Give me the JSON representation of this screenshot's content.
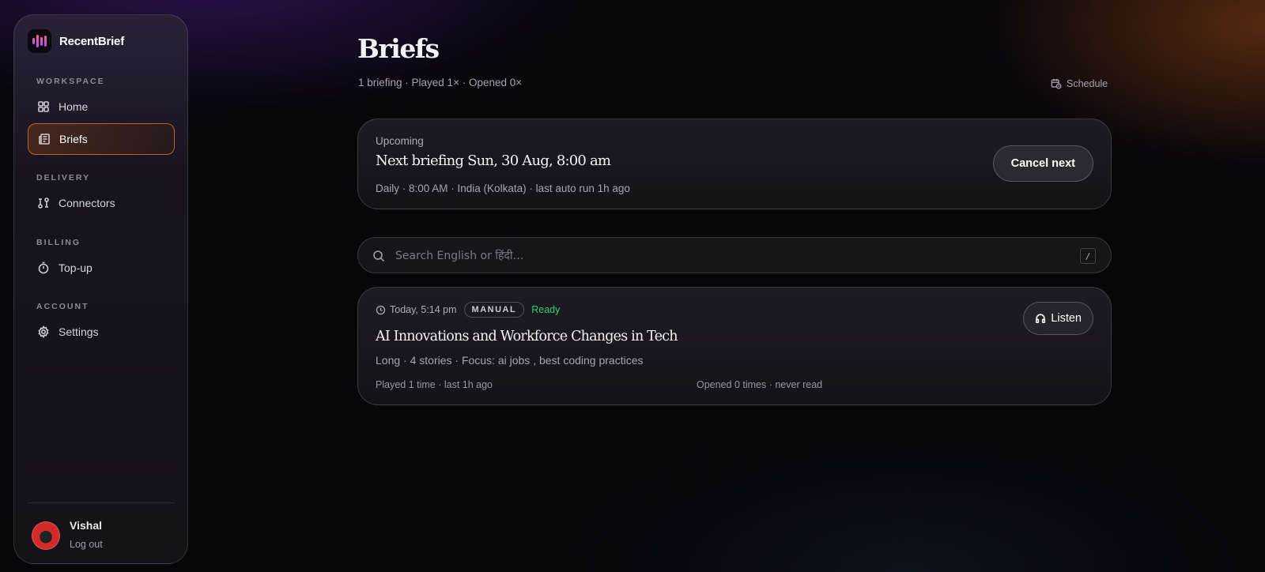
{
  "app": {
    "name": "RecentBrief"
  },
  "sidebar": {
    "sections": [
      {
        "label": "WORKSPACE",
        "items": [
          {
            "label": "Home",
            "icon": "grid-icon"
          },
          {
            "label": "Briefs",
            "icon": "newspaper-icon",
            "active": true
          }
        ]
      },
      {
        "label": "DELIVERY",
        "items": [
          {
            "label": "Connectors",
            "icon": "connectors-icon"
          }
        ]
      },
      {
        "label": "BILLING",
        "items": [
          {
            "label": "Top-up",
            "icon": "timer-icon"
          }
        ]
      },
      {
        "label": "ACCOUNT",
        "items": [
          {
            "label": "Settings",
            "icon": "gear-icon"
          }
        ]
      }
    ],
    "user": {
      "name": "Vishal",
      "logout_label": "Log out"
    }
  },
  "page": {
    "title": "Briefs",
    "subtitle": "1 briefing · Played 1× · Opened 0×",
    "schedule_label": "Schedule"
  },
  "upcoming": {
    "label": "Upcoming",
    "title": "Next briefing Sun, 30 Aug, 8:00 am",
    "meta": "Daily · 8:00 AM · India (Kolkata) · last auto run 1h ago",
    "cancel_label": "Cancel next"
  },
  "search": {
    "placeholder": "Search English or हिंदी…",
    "shortcut": "/"
  },
  "briefs": [
    {
      "time": "Today, 5:14 pm",
      "badge": "MANUAL",
      "status": "Ready",
      "title": "AI Innovations and Workforce Changes in Tech",
      "meta": "Long · 4 stories · Focus: ai jobs , best coding practices",
      "played": "Played 1 time · last 1h ago",
      "opened": "Opened 0 times · never read",
      "listen_label": "Listen"
    }
  ],
  "colors": {
    "accent": "#b8652a",
    "status_ready": "#2bd46b",
    "background": "#07060b"
  }
}
